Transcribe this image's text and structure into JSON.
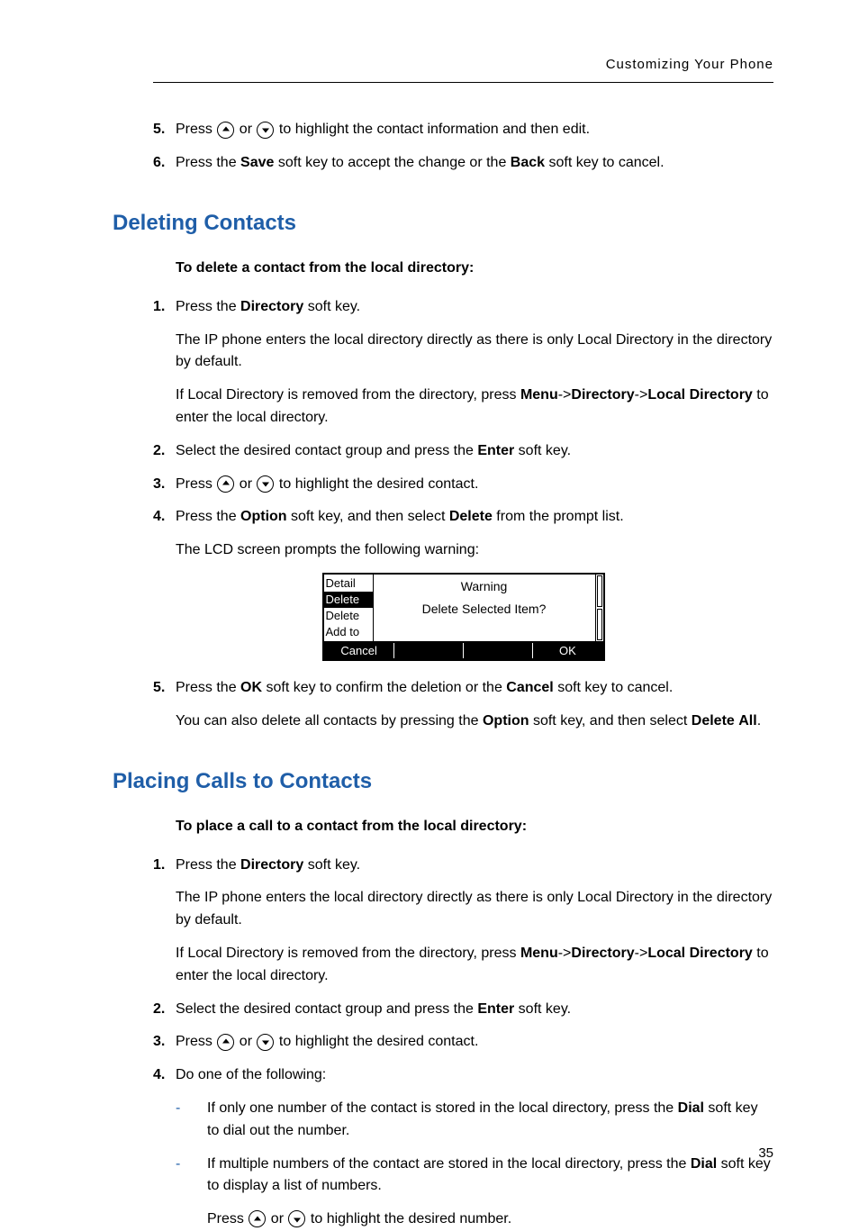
{
  "header_right": "Customizing Your Phone",
  "top_item5": {
    "num": "5.",
    "pre": "Press ",
    "mid": " or ",
    "post": " to highlight the contact information and then edit."
  },
  "top_item6": {
    "num": "6.",
    "t1": "Press the ",
    "save": "Save",
    "t2": " soft key to accept the change or the ",
    "back": "Back",
    "t3": " soft key to cancel."
  },
  "h_deleting": "Deleting Contacts",
  "del_intro": "To delete a contact from the local directory:",
  "del": {
    "i1": {
      "num": "1.",
      "t1": "Press the ",
      "dir": "Directory",
      "t2": " soft key."
    },
    "i1p1": "The IP phone enters the local directory directly as there is only Local Directory in the directory by default.",
    "i1p2a": "If Local Directory is removed from the directory, press ",
    "i1p2_menu": "Menu",
    "i1p2_s1": "->",
    "i1p2_dir": "Directory",
    "i1p2_s2": "->",
    "i1p2_ld1": "Local",
    "i1p2_ld2": "Directory",
    "i1p2b": " to enter the local directory.",
    "i2": {
      "num": "2.",
      "t1": "Select the desired contact group and press the ",
      "enter": "Enter",
      "t2": " soft key."
    },
    "i3": {
      "num": "3.",
      "pre": "Press ",
      "mid": " or ",
      "post": " to highlight the desired contact."
    },
    "i4": {
      "num": "4.",
      "t1": "Press the ",
      "opt": "Option",
      "t2": " soft key, and then select ",
      "delb": "Delete",
      "t3": " from the prompt list."
    },
    "i4p1": "The LCD screen prompts the following warning:"
  },
  "lcd": {
    "menu1": "Detail",
    "menu2": "Delete",
    "menu3": "Delete",
    "menu4": "Add to",
    "warning": "Warning",
    "msg": "Delete Selected Item?",
    "sk_cancel": "Cancel",
    "sk_ok": "OK"
  },
  "del5": {
    "num": "5.",
    "t1": "Press the ",
    "ok": "OK",
    "t2": " soft key to confirm the deletion or the ",
    "cancel": "Cancel",
    "t3": " soft key to cancel."
  },
  "del_also": {
    "t1": "You can also delete all contacts by pressing the ",
    "opt": "Option",
    "t2": " soft key, and then select ",
    "da1": "Delete",
    "da2": "All",
    "t3": "."
  },
  "h_placing": "Placing Calls to Contacts",
  "pl_intro": "To place a call to a contact from the local directory:",
  "pl": {
    "i1": {
      "num": "1.",
      "t1": "Press the ",
      "dir": "Directory",
      "t2": " soft key."
    },
    "i1p1": "The IP phone enters the local directory directly as there is only Local Directory in the directory by default.",
    "i1p2a": "If Local Directory is removed from the directory, press ",
    "i1p2_menu": "Menu",
    "i1p2_s1": "->",
    "i1p2_dir": "Directory",
    "i1p2_s2": "->",
    "i1p2_ld1": "Local",
    "i1p2_ld2": "Directory",
    "i1p2b": " to enter the local directory.",
    "i2": {
      "num": "2.",
      "t1": "Select the desired contact group and press the ",
      "enter": "Enter",
      "t2": " soft key."
    },
    "i3": {
      "num": "3.",
      "pre": "Press ",
      "mid": " or ",
      "post": " to highlight the desired contact."
    },
    "i4": {
      "num": "4.",
      "t": "Do one of the following:"
    }
  },
  "pl_dash1": {
    "t1": "If only one number of the contact is stored in the local directory, press the ",
    "dial": "Dial",
    "t2": " soft key to dial out the number."
  },
  "pl_dash2": {
    "t1": "If multiple numbers of the contact are stored in the local directory, press the ",
    "dial": "Dial",
    "t2": " soft key to display a list of numbers."
  },
  "pl_dash2_sub": {
    "pre": "Press ",
    "mid": " or ",
    "post": " to highlight the desired number."
  },
  "page_number": "35"
}
